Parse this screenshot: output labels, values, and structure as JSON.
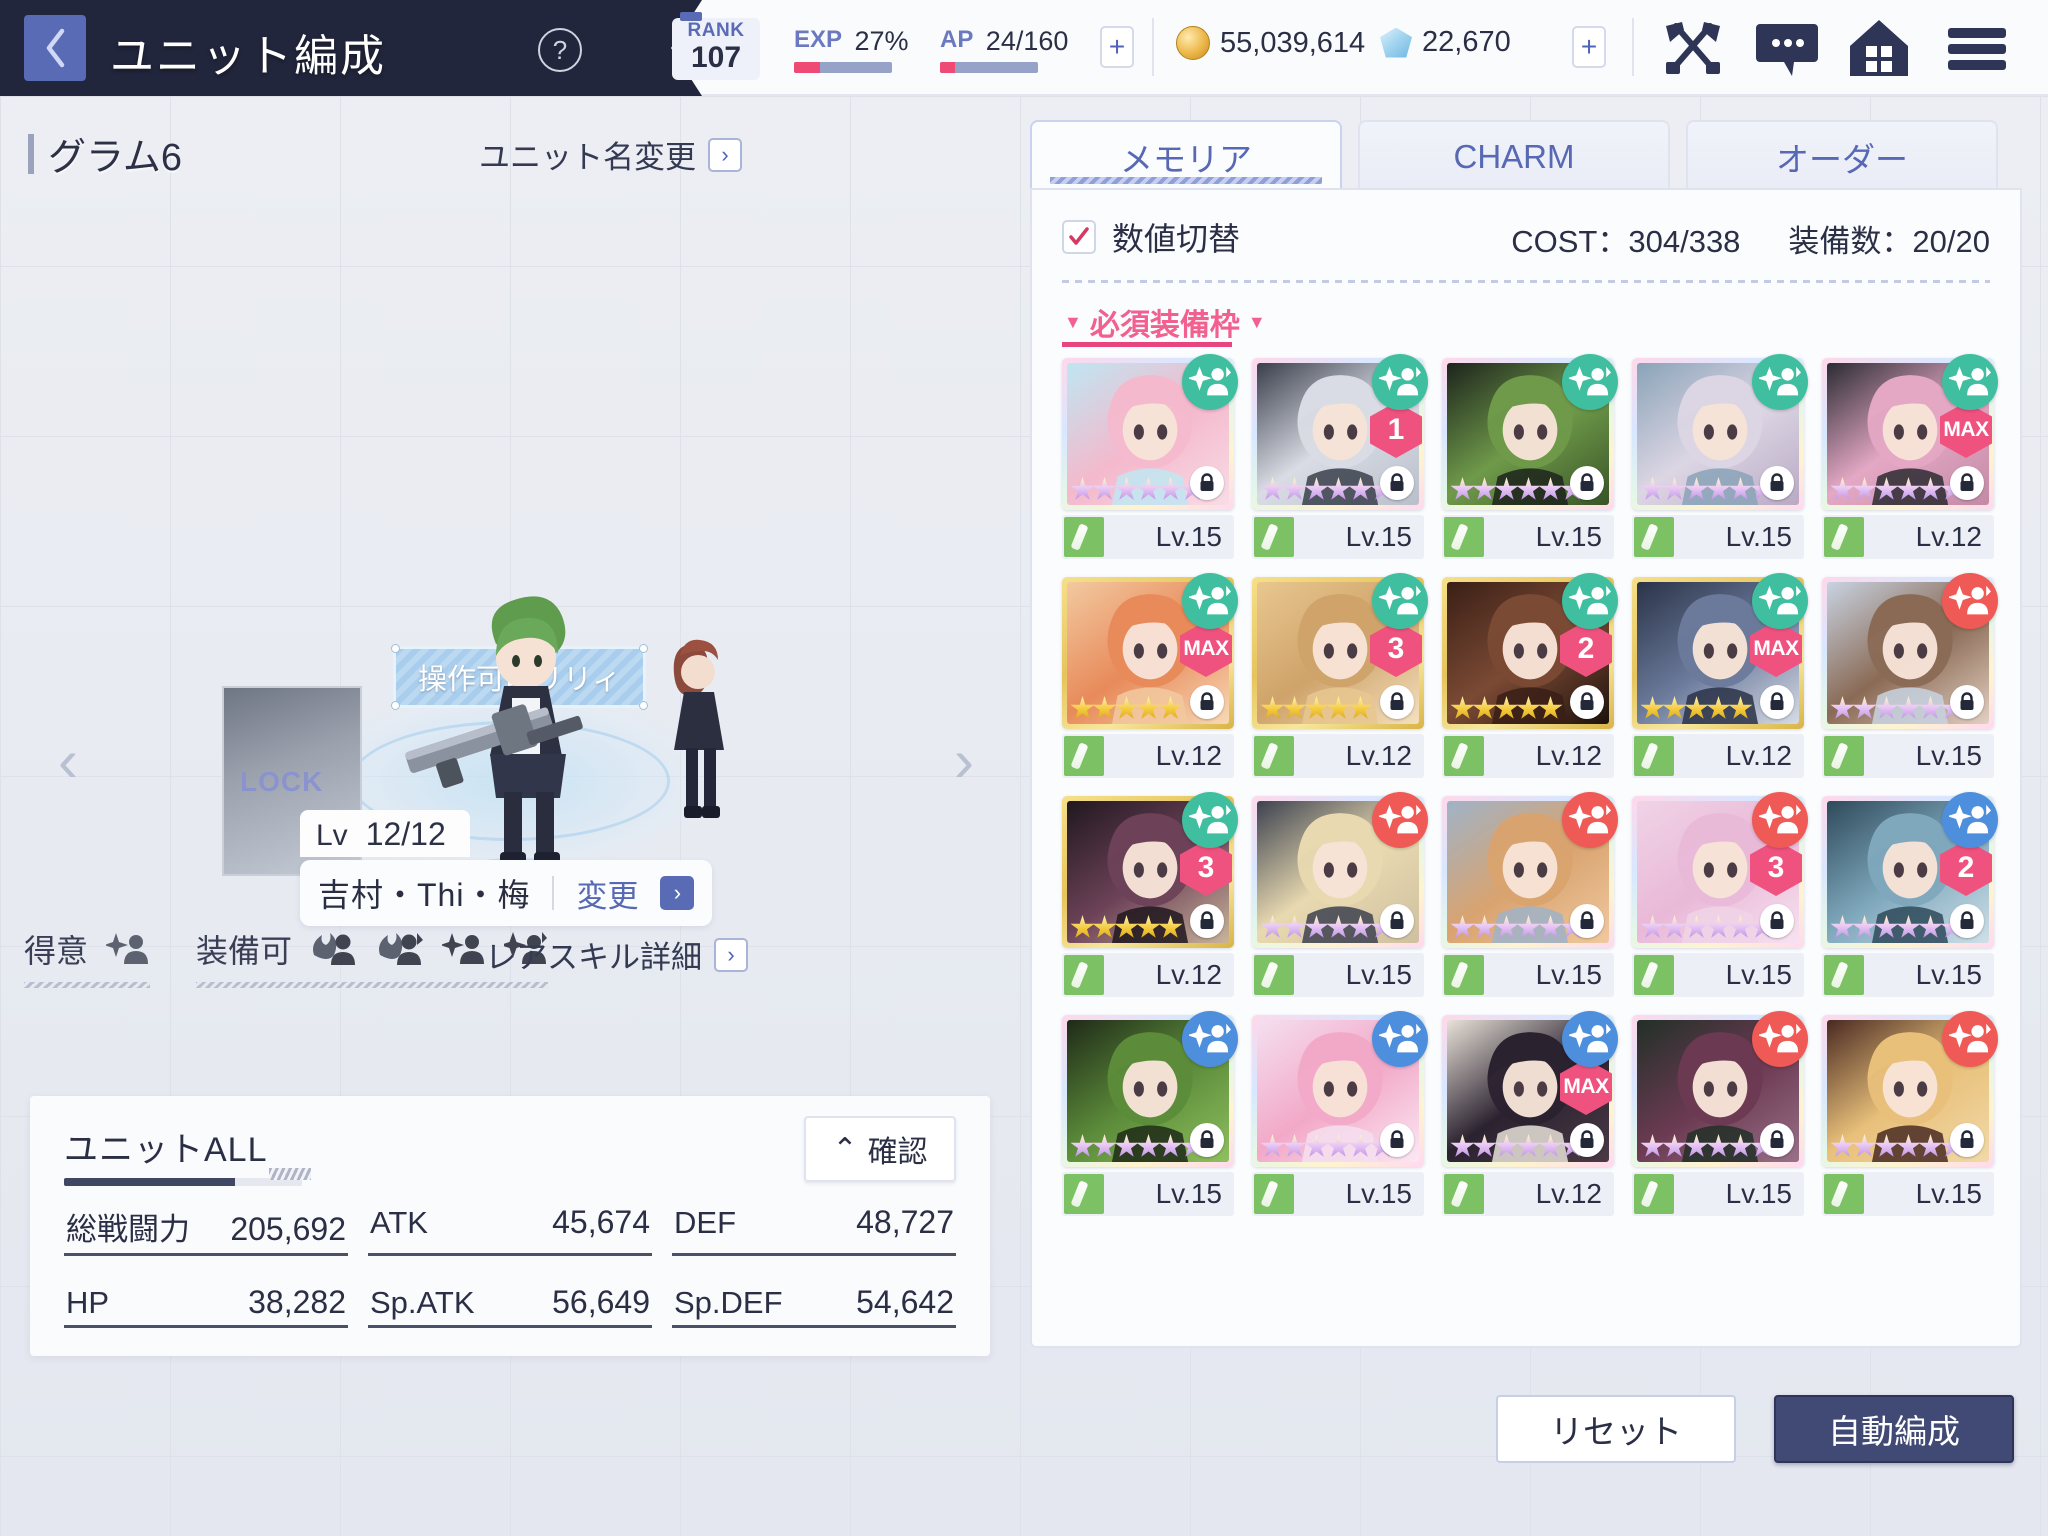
{
  "header": {
    "back_icon": "chevron-left-icon",
    "title": "ユニット編成",
    "help_icon": "question-mark-icon",
    "rank_label": "RANK",
    "rank_value": "107",
    "exp_label": "EXP",
    "exp_value": "27%",
    "exp_percent": 27,
    "ap_label": "AP",
    "ap_value": "24/160",
    "ap_percent": 15,
    "ap_plus": "+",
    "gold_icon": "coin-icon",
    "gold_value": "55,039,614",
    "gem_icon": "gem-icon",
    "gem_value": "22,670",
    "gem_plus": "+",
    "icons": [
      "crossed-swords-icon",
      "chat-bubble-icon",
      "home-icon",
      "hamburger-menu-icon"
    ],
    "accent_color": "#5a6bb5",
    "dark_color": "#22263c"
  },
  "left": {
    "unit_name": "グラム6",
    "rename_label": "ユニット名変更",
    "stage_tag": "操作可能リリィ",
    "lock_text": "LOCK",
    "arrow_left": "‹",
    "arrow_right": "›",
    "level_key": "Lv",
    "level_value": "12/12",
    "character_name": "吉村・Thi・梅",
    "change_label": "変更",
    "trait_specialty_label": "得意",
    "trait_equip_label": "装備可",
    "specialty_icons": [
      "sparkle-person-icon"
    ],
    "equip_icons": [
      "flame-person-icon",
      "flame-person-alt-icon",
      "sparkle-person-icon",
      "sparkle-person-alt-icon"
    ],
    "rare_skill_label": "レアスキル詳細",
    "stats": {
      "unit_all_label": "ユニットALL",
      "confirm_label": "確認",
      "confirm_caret": "⌃",
      "rows": [
        {
          "key": "総戦闘力",
          "value": "205,692"
        },
        {
          "key": "ATK",
          "value": "45,674"
        },
        {
          "key": "DEF",
          "value": "48,727"
        },
        {
          "key": "HP",
          "value": "38,282"
        },
        {
          "key": "Sp.ATK",
          "value": "56,649"
        },
        {
          "key": "Sp.DEF",
          "value": "54,642"
        }
      ]
    }
  },
  "right": {
    "tabs": [
      {
        "label": "メモリア",
        "active": true
      },
      {
        "label": "CHARM",
        "active": false
      },
      {
        "label": "オーダー",
        "active": false
      }
    ],
    "toggle_label": "数値切替",
    "toggle_checked": true,
    "cost_label": "COST：304/338",
    "equip_count_label": "装備数：20/20",
    "required_slot_label": "必須装備枠",
    "required_slot_color": "#e8447e",
    "cards": [
      {
        "level": "Lv.15",
        "stars": 6,
        "frame": "rainbow",
        "badge": "green",
        "badge_icon": "sparkle-person-icon",
        "count": "",
        "locked": true,
        "art": [
          "#bfe6f2",
          "#f4b9cc",
          "#f8dce6"
        ]
      },
      {
        "level": "Lv.15",
        "stars": 6,
        "frame": "rainbow",
        "badge": "green",
        "badge_icon": "sparkle-person-icon",
        "count": "1",
        "locked": true,
        "art": [
          "#3a3f4c",
          "#d9dce4",
          "#b9bfcb"
        ]
      },
      {
        "level": "Lv.15",
        "stars": 6,
        "frame": "rainbow",
        "badge": "green",
        "badge_icon": "sparkle-person-icon",
        "count": "",
        "locked": true,
        "art": [
          "#1d241c",
          "#6f9a4a",
          "#395427"
        ]
      },
      {
        "level": "Lv.15",
        "stars": 6,
        "frame": "rainbow",
        "badge": "green",
        "badge_icon": "sparkle-person-icon",
        "count": "",
        "locked": true,
        "art": [
          "#8aa3b8",
          "#dcd6e4",
          "#b9a9c4"
        ]
      },
      {
        "level": "Lv.12",
        "stars": 6,
        "frame": "rainbow",
        "badge": "green",
        "badge_icon": "sparkle-person-icon",
        "count": "MAX",
        "locked": true,
        "art": [
          "#2b2b33",
          "#e4a8c4",
          "#c38aa6"
        ]
      },
      {
        "level": "Lv.12",
        "stars": 5,
        "frame": "gold",
        "badge": "green",
        "badge_icon": "sparkle-person-icon",
        "count": "MAX",
        "locked": true,
        "art": [
          "#f2c9a0",
          "#e88a5a",
          "#f7d9b6"
        ]
      },
      {
        "level": "Lv.12",
        "stars": 5,
        "frame": "gold",
        "badge": "green",
        "badge_icon": "sparkle-person-icon",
        "count": "3",
        "locked": true,
        "art": [
          "#e8c78f",
          "#cfa36a",
          "#f4e0bf"
        ]
      },
      {
        "level": "Lv.12",
        "stars": 5,
        "frame": "gold",
        "badge": "green",
        "badge_icon": "sparkle-person-icon",
        "count": "2",
        "locked": true,
        "art": [
          "#3a1f16",
          "#7b4a34",
          "#1d120d"
        ]
      },
      {
        "level": "Lv.12",
        "stars": 5,
        "frame": "gold",
        "badge": "green",
        "badge_icon": "sparkle-person-icon",
        "count": "MAX",
        "locked": true,
        "art": [
          "#2a3348",
          "#6b7a9b",
          "#d6dbe6"
        ]
      },
      {
        "level": "Lv.15",
        "stars": 6,
        "frame": "rainbow",
        "badge": "red",
        "badge_icon": "sparkle-person-icon",
        "count": "",
        "locked": true,
        "art": [
          "#c8d3e2",
          "#8a6a55",
          "#e3d0c2"
        ]
      },
      {
        "level": "Lv.12",
        "stars": 5,
        "frame": "gold",
        "badge": "green",
        "badge_icon": "sparkle-person-icon",
        "count": "3",
        "locked": true,
        "art": [
          "#20181f",
          "#6d4258",
          "#c9b49a"
        ]
      },
      {
        "level": "Lv.15",
        "stars": 6,
        "frame": "rainbow",
        "badge": "red",
        "badge_icon": "sparkle-person-icon",
        "count": "",
        "locked": true,
        "art": [
          "#3d4250",
          "#e8d9b0",
          "#cfc0a0"
        ]
      },
      {
        "level": "Lv.15",
        "stars": 6,
        "frame": "rainbow",
        "badge": "red",
        "badge_icon": "sparkle-person-icon",
        "count": "",
        "locked": true,
        "art": [
          "#9fb3c8",
          "#d9a36f",
          "#f0c9a0"
        ]
      },
      {
        "level": "Lv.15",
        "stars": 6,
        "frame": "rainbow",
        "badge": "red",
        "badge_icon": "sparkle-person-icon",
        "count": "3",
        "locked": true,
        "art": [
          "#f0d3e6",
          "#e9b9d8",
          "#f7e2f0"
        ]
      },
      {
        "level": "Lv.15",
        "stars": 6,
        "frame": "rainbow",
        "badge": "blue",
        "badge_icon": "sparkle-person-icon",
        "count": "2",
        "locked": true,
        "art": [
          "#2e4a5a",
          "#7fa8bd",
          "#cfe0e8"
        ]
      },
      {
        "level": "Lv.15",
        "stars": 6,
        "frame": "rainbow",
        "badge": "blue",
        "badge_icon": "sparkle-person-icon",
        "count": "",
        "locked": true,
        "art": [
          "#1f2a18",
          "#5c8c3a",
          "#8fbf5e"
        ]
      },
      {
        "level": "Lv.15",
        "stars": 6,
        "frame": "rainbow",
        "badge": "blue",
        "badge_icon": "sparkle-person-icon",
        "count": "",
        "locked": true,
        "art": [
          "#f5dff0",
          "#f2a9c8",
          "#fbe8f4"
        ]
      },
      {
        "level": "Lv.12",
        "stars": 6,
        "frame": "rainbow",
        "badge": "blue",
        "badge_icon": "sparkle-person-icon",
        "count": "MAX",
        "locked": true,
        "art": [
          "#e8e2d8",
          "#2b2230",
          "#4a3a46"
        ]
      },
      {
        "level": "Lv.15",
        "stars": 6,
        "frame": "rainbow",
        "badge": "red",
        "badge_icon": "sparkle-person-icon",
        "count": "",
        "locked": true,
        "art": [
          "#223028",
          "#6b3a52",
          "#9a7089"
        ]
      },
      {
        "level": "Lv.15",
        "stars": 6,
        "frame": "rainbow",
        "badge": "red",
        "badge_icon": "sparkle-person-icon",
        "count": "",
        "locked": true,
        "art": [
          "#4a2a22",
          "#e8c07a",
          "#f2d9a8"
        ]
      }
    ],
    "slot_icon": "blade-slot-icon"
  },
  "bottom": {
    "reset_label": "リセット",
    "auto_label": "自動編成"
  }
}
